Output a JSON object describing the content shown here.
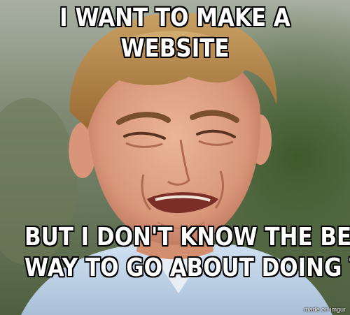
{
  "meme": {
    "top_text": [
      "I WANT TO MAKE A",
      "WEBSITE"
    ],
    "bottom_text": [
      "BUT I DON'T KNOW THE BEST",
      "WAY TO GO ABOUT DOING THAT"
    ],
    "watermark": "made on imgur"
  },
  "colors": {
    "caption_fill": "#ffffff",
    "caption_stroke": "#000000",
    "background_blur": "#6b7a5a",
    "hair": "#b58a4a",
    "skin": "#e3a98a",
    "shirt": "#bcd0e6"
  },
  "icons": [
    "crying-face-photo"
  ]
}
